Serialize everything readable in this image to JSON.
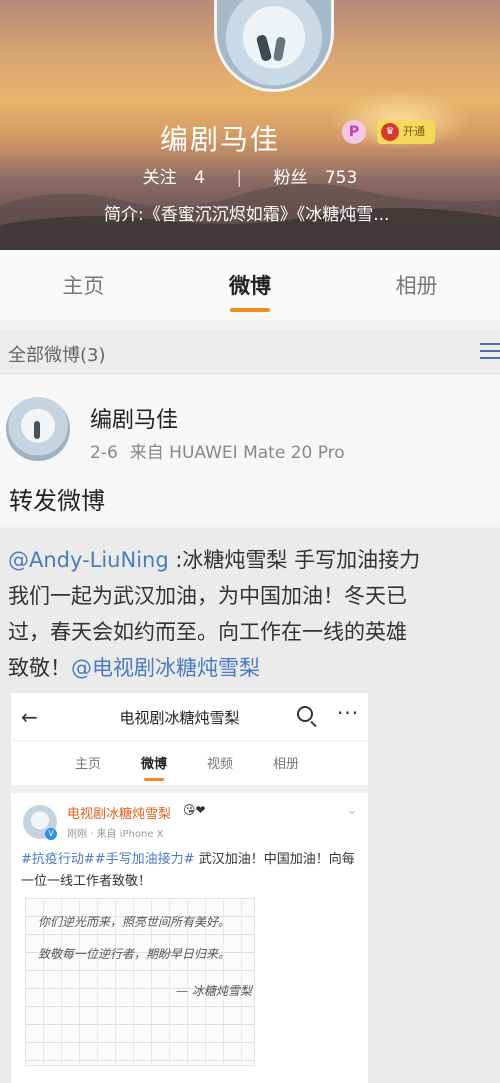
{
  "profile": {
    "name": "编剧马佳",
    "vip_badge": "开通",
    "following_label": "关注",
    "following_count": "4",
    "fans_label": "粉丝",
    "fans_count": "753",
    "intro": "简介:《香蜜沉沉烬如霜》《冰糖炖雪..."
  },
  "tabs": [
    {
      "label": "主页",
      "active": false
    },
    {
      "label": "微博",
      "active": true
    },
    {
      "label": "相册",
      "active": false
    }
  ],
  "filter": {
    "label": "全部微博(3)"
  },
  "post": {
    "author": "编剧马佳",
    "date": "2-6",
    "source": "来自 HUAWEI Mate 20 Pro",
    "text": "转发微博"
  },
  "repost": {
    "mention": "@Andy-LiuNing",
    "line1_rest": " :冰糖炖雪梨 手写加油接力",
    "line2": "我们一起为武汉加油，为中国加油！冬天已",
    "line3": "过，春天会如约而至。向工作在一线的英雄",
    "line4_prefix": "致敬！",
    "line4_link": "@电视剧冰糖炖雪梨"
  },
  "embedded": {
    "title": "电视剧冰糖炖雪梨",
    "back": "←",
    "more": "···",
    "tabs": [
      "主页",
      "微博",
      "视频",
      "相册"
    ],
    "active_tab": 1,
    "author": "电视剧冰糖炖雪梨",
    "emoji": "😘❤",
    "meta": "刚刚 · 来自 iPhone X",
    "hashtags": "#抗疫行动##手写加油接力#",
    "text1_rest": " 武汉加油！中国加油！向每",
    "text2": "一位一线工作者致敬！",
    "handwriting": {
      "line1": "你们逆光而来，照亮世间所有美好。",
      "line2": "致敬每一位逆行者，期盼早日归来。",
      "line3": "— 冰糖炖雪梨"
    }
  },
  "colors": {
    "accent": "#f28a22",
    "link": "#4a7bc0"
  }
}
